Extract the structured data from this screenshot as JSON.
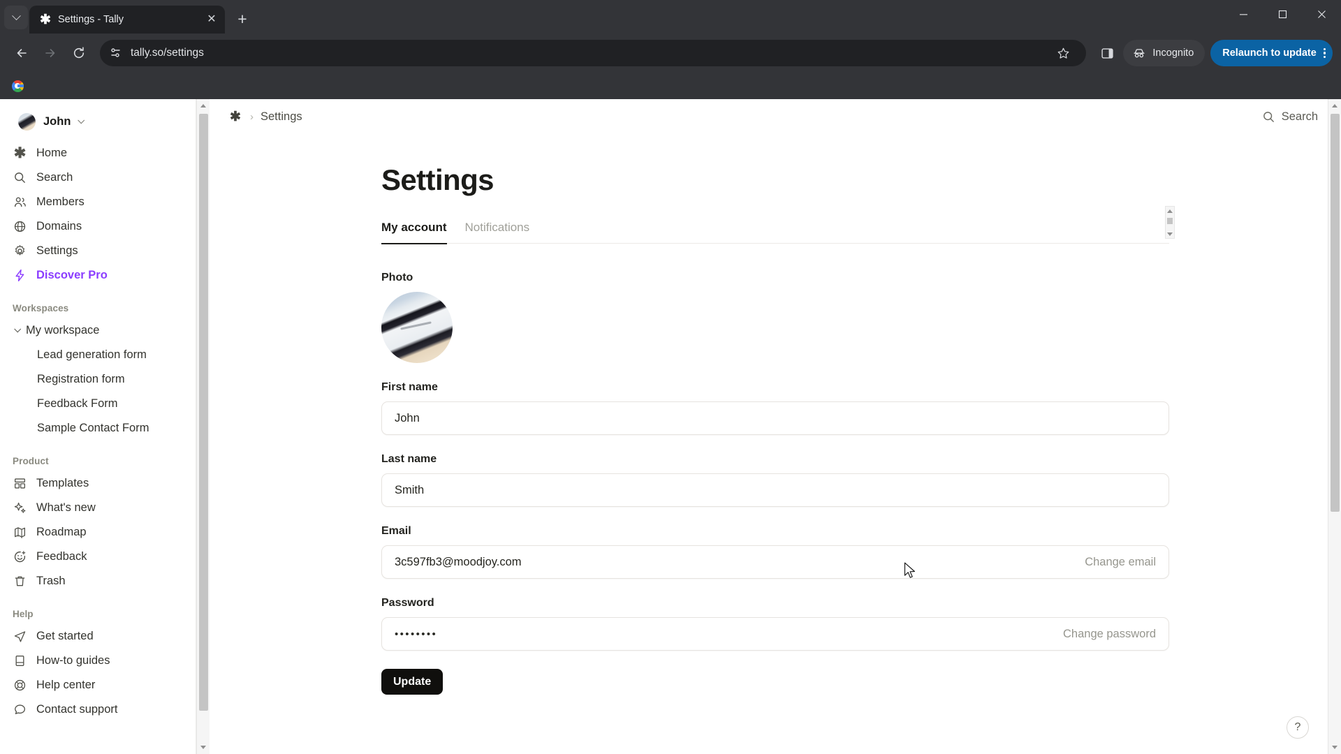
{
  "browser": {
    "tab": {
      "title": "Settings - Tally",
      "favicon_icon": "asterisk-icon",
      "close_icon": "close-icon"
    },
    "tab_search_icon": "chevron-down-icon",
    "new_tab_icon": "plus-icon",
    "window_controls": {
      "minimize": "minimize-icon",
      "maximize": "maximize-icon",
      "close": "close-icon"
    },
    "nav": {
      "back_icon": "back-arrow-icon",
      "forward_icon": "forward-arrow-icon",
      "reload_icon": "reload-icon"
    },
    "omnibox": {
      "url": "tally.so/settings",
      "site_info_icon": "site-settings-icon",
      "bookmark_icon": "star-icon"
    },
    "side_panel_icon": "side-panel-icon",
    "incognito": {
      "label": "Incognito",
      "icon": "incognito-icon"
    },
    "relaunch": {
      "label": "Relaunch to update",
      "menu_icon": "kebab-menu-icon"
    },
    "bookmarks": [
      {
        "name": "google-bookmark",
        "icon": "google-logo-icon"
      }
    ],
    "accent_blue": "#0b63a4",
    "chrome_bg": "#333438"
  },
  "app": {
    "sidebar": {
      "user": {
        "name": "John",
        "chevron_icon": "chevron-down-icon",
        "avatar_icon": "avatar"
      },
      "nav": [
        {
          "label": "Home",
          "icon": "asterisk-icon"
        },
        {
          "label": "Search",
          "icon": "search-icon"
        },
        {
          "label": "Members",
          "icon": "members-icon"
        },
        {
          "label": "Domains",
          "icon": "globe-icon"
        },
        {
          "label": "Settings",
          "icon": "gear-icon"
        },
        {
          "label": "Discover Pro",
          "icon": "lightning-icon",
          "accent": "#8b3dff"
        }
      ],
      "workspaces_heading": "Workspaces",
      "workspace": {
        "label": "My workspace",
        "chevron_icon": "chevron-down-icon"
      },
      "forms": [
        {
          "label": "Lead generation form"
        },
        {
          "label": "Registration form"
        },
        {
          "label": "Feedback Form"
        },
        {
          "label": "Sample Contact Form"
        }
      ],
      "product_heading": "Product",
      "product": [
        {
          "label": "Templates",
          "icon": "templates-icon"
        },
        {
          "label": "What's new",
          "icon": "sparkles-icon"
        },
        {
          "label": "Roadmap",
          "icon": "map-icon"
        },
        {
          "label": "Feedback",
          "icon": "smiley-plus-icon"
        },
        {
          "label": "Trash",
          "icon": "trash-icon"
        }
      ],
      "help_heading": "Help",
      "help": [
        {
          "label": "Get started",
          "icon": "paper-plane-icon"
        },
        {
          "label": "How-to guides",
          "icon": "book-icon"
        },
        {
          "label": "Help center",
          "icon": "help-circle-icon"
        },
        {
          "label": "Contact support",
          "icon": "chat-bubble-icon"
        }
      ]
    },
    "topbar": {
      "breadcrumb_home_icon": "asterisk-icon",
      "breadcrumb_separator": "›",
      "breadcrumb_label": "Settings",
      "search": {
        "label": "Search",
        "icon": "search-icon"
      }
    },
    "page": {
      "title": "Settings",
      "tabs": [
        {
          "label": "My account",
          "active": true
        },
        {
          "label": "Notifications",
          "active": false
        }
      ],
      "fields": {
        "photo": {
          "label": "Photo"
        },
        "first_name": {
          "label": "First name",
          "value": "John",
          "placeholder": "First name"
        },
        "last_name": {
          "label": "Last name",
          "value": "Smith",
          "placeholder": "Last name"
        },
        "email": {
          "label": "Email",
          "value": "3c597fb3@moodjoy.com",
          "action": "Change email"
        },
        "password": {
          "label": "Password",
          "value": "••••••••",
          "action": "Change password"
        }
      },
      "update_button": "Update"
    },
    "help_fab": {
      "label": "?",
      "icon": "question-mark-icon"
    }
  }
}
